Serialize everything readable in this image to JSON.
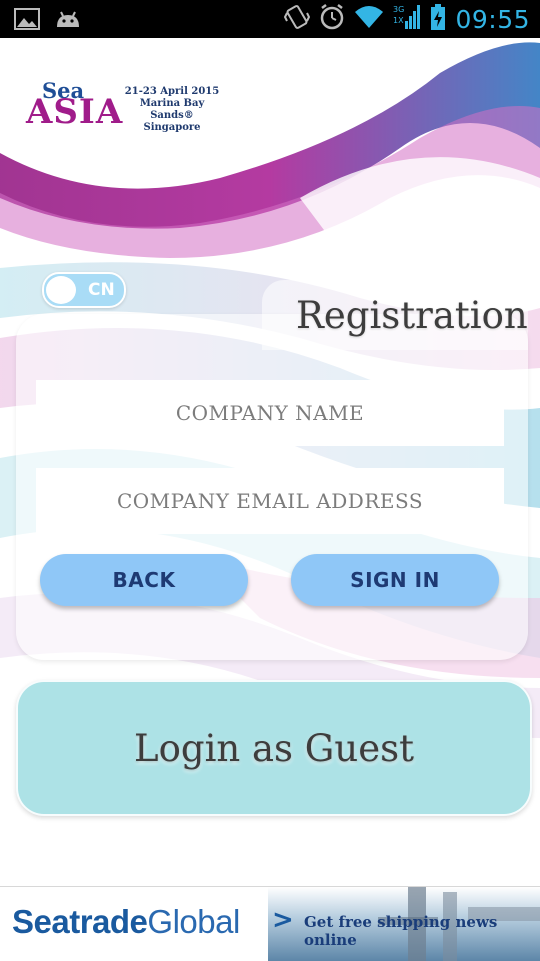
{
  "status_bar": {
    "time": "09:55",
    "icons": [
      "image-icon",
      "android-icon",
      "vibrate-icon",
      "alarm-icon",
      "wifi-icon",
      "signal-icon",
      "battery-icon"
    ]
  },
  "logo": {
    "word1": "Sea",
    "word2": "ASIA",
    "dates": "21-23 April 2015",
    "venue": "Marina Bay Sands®",
    "city": "Singapore"
  },
  "language_toggle": {
    "label": "CN",
    "state": "off"
  },
  "registration": {
    "title": "Registration",
    "company_name_placeholder": "COMPANY NAME",
    "company_email_placeholder": "COMPANY EMAIL ADDRESS",
    "back_label": "BACK",
    "signin_label": "SIGN IN"
  },
  "guest": {
    "label": "Login as Guest"
  },
  "ad": {
    "brand_part1": "Seatrade",
    "brand_part2": "Global",
    "arrow": ">",
    "text": "Get free shipping news online"
  },
  "colors": {
    "accent_purple": "#a01c8a",
    "button_blue": "#8fc7f7",
    "guest_teal": "#ade2e6",
    "statusbar_blue": "#33b5e5"
  }
}
